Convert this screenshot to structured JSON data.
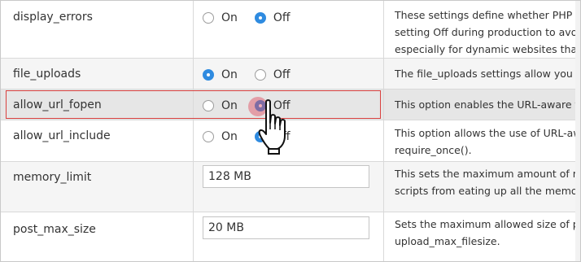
{
  "settings": {
    "display_errors": {
      "name": "display_errors",
      "on_label": "On",
      "off_label": "Off",
      "selected": "Off",
      "desc_line1": "These settings define whether PHP sh",
      "desc_line2": "setting Off during production to avoi",
      "desc_line3": "especially for dynamic websites that s"
    },
    "file_uploads": {
      "name": "file_uploads",
      "on_label": "On",
      "off_label": "Off",
      "selected": "On",
      "desc_line1": "The file_uploads settings allow you to"
    },
    "allow_url_fopen": {
      "name": "allow_url_fopen",
      "on_label": "On",
      "off_label": "Off",
      "selected": "Off",
      "desc_line1": "This option enables the URL-aware fo"
    },
    "allow_url_include": {
      "name": "allow_url_include",
      "on_label": "On",
      "off_label": "Off",
      "selected": "Off",
      "desc_line1": "This option allows the use of URL-awa",
      "desc_line2": "require_once()."
    },
    "memory_limit": {
      "name": "memory_limit",
      "value": "128 MB",
      "desc_line1": "This sets the maximum amount of me",
      "desc_line2": "scripts from eating up all the memory"
    },
    "post_max_size": {
      "name": "post_max_size",
      "value": "20 MB",
      "desc_line1": "Sets the maximum allowed size of po",
      "desc_line2": "upload_max_filesize."
    }
  },
  "colors": {
    "radio_checked": "#2f8be0",
    "highlight_border": "#d9413f",
    "click_ring": "#e1465a"
  },
  "icons": {
    "cursor": "hand-pointer-icon"
  }
}
